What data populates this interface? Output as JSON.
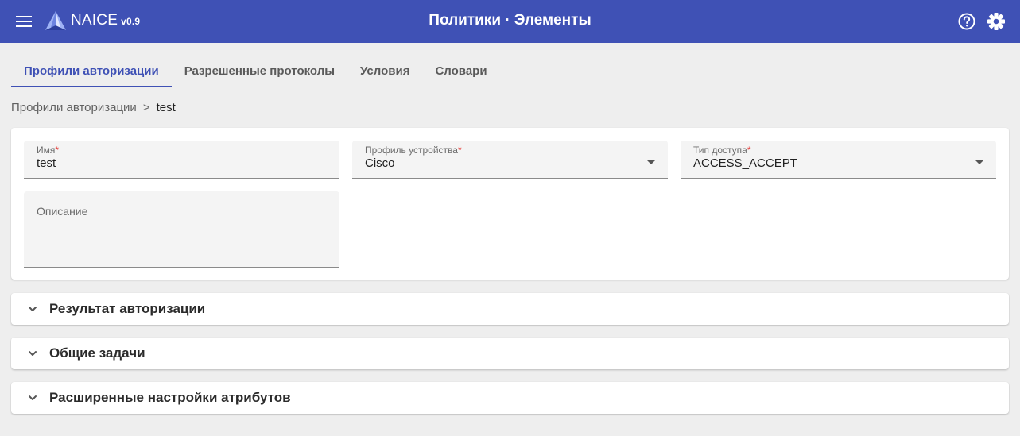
{
  "header": {
    "app_name": "NAICE",
    "app_version": "v0.9",
    "page_title": "Политики · Элементы",
    "background_color": "#3f51b5",
    "icons": [
      "menu-icon",
      "naice-logo-icon",
      "help-icon",
      "gear-icon"
    ]
  },
  "tabs": [
    {
      "label": "Профили авторизации",
      "active": true
    },
    {
      "label": "Разрешенные протоколы",
      "active": false
    },
    {
      "label": "Условия",
      "active": false
    },
    {
      "label": "Словари",
      "active": false
    }
  ],
  "breadcrumb": {
    "parent": "Профили авторизации",
    "separator": ">",
    "current": "test"
  },
  "form": {
    "name": {
      "label": "Имя",
      "required_mark": "*",
      "value": "test"
    },
    "device_profile": {
      "label": "Профиль устройства",
      "required_mark": "*",
      "value": "Cisco"
    },
    "access_type": {
      "label": "Тип доступа",
      "required_mark": "*",
      "value": "ACCESS_ACCEPT"
    },
    "description": {
      "label": "Описание",
      "value": ""
    }
  },
  "panels": [
    {
      "title": "Результат авторизации",
      "expanded": false
    },
    {
      "title": "Общие задачи",
      "expanded": false
    },
    {
      "title": "Расширенные настройки атрибутов",
      "expanded": false
    }
  ],
  "colors": {
    "accent": "#3f51b5",
    "required": "#e53935",
    "page_background": "#eeeeee"
  }
}
